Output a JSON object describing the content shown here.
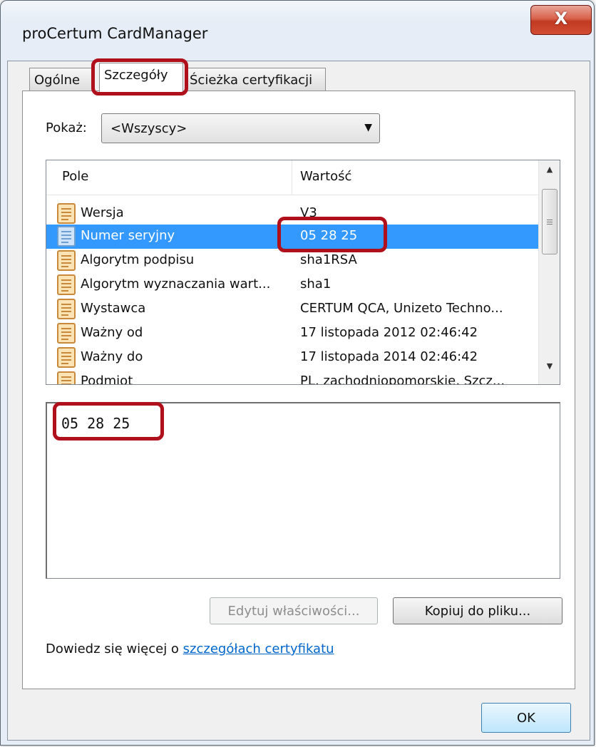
{
  "window": {
    "title": "proCertum CardManager",
    "close_label": "X"
  },
  "tabs": [
    {
      "label": "Ogólne",
      "active": false
    },
    {
      "label": "Szczegóły",
      "active": true
    },
    {
      "label": "Ścieżka certyfikacji",
      "active": false
    }
  ],
  "show": {
    "label": "Pokaż:",
    "selected": "<Wszyscy>"
  },
  "list": {
    "headers": {
      "field": "Pole",
      "value": "Wartość"
    },
    "rows": [
      {
        "field": "Wersja",
        "value": "V3",
        "selected": false
      },
      {
        "field": "Numer seryjny",
        "value": "05 28 25",
        "selected": true
      },
      {
        "field": "Algorytm podpisu",
        "value": "sha1RSA",
        "selected": false
      },
      {
        "field": "Algorytm wyznaczania wart...",
        "value": "sha1",
        "selected": false
      },
      {
        "field": "Wystawca",
        "value": "CERTUM QCA, Unizeto Techno...",
        "selected": false
      },
      {
        "field": "Ważny od",
        "value": "17 listopada 2012 02:46:42",
        "selected": false
      },
      {
        "field": "Ważny do",
        "value": "17 listopada 2014 02:46:42",
        "selected": false
      },
      {
        "field": "Podmiot",
        "value": "PL, zachodniopomorskie, Szcz...",
        "selected": false
      }
    ]
  },
  "detail": {
    "text": "05 28 25"
  },
  "buttons": {
    "edit": "Edytuj właściwości...",
    "copy": "Kopiuj do pliku...",
    "ok": "OK"
  },
  "learn_more": {
    "prefix": "Dowiedz się więcej o ",
    "link": "szczegółach certyfikatu"
  },
  "colors": {
    "highlight": "#b0101c",
    "selection": "#3399ff",
    "link": "#0066cc"
  }
}
